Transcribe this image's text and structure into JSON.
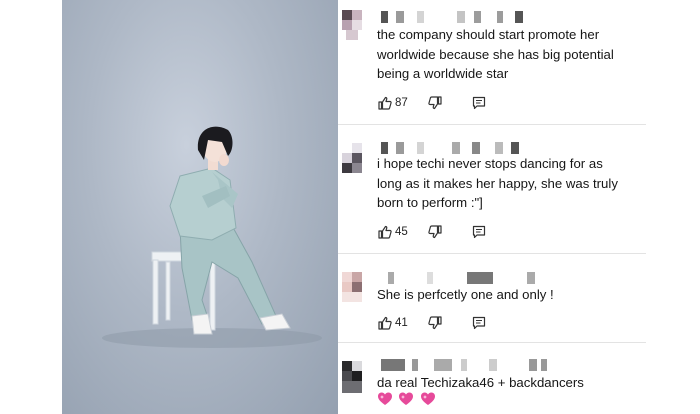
{
  "photo": {
    "icon": "seated-person-photo"
  },
  "comments": [
    {
      "text": "the company should start promote her\nworldwide because she has big potential\nbeing a worldwide star",
      "likes": "87"
    },
    {
      "text": "i hope techi never stops dancing for as\nlong as it makes her happy, she was truly\nborn to perform :\"]",
      "likes": "45"
    },
    {
      "text": "She is perfcetly one and only !",
      "likes": "41"
    },
    {
      "text": "da real Techizaka46 + backdancers",
      "emoji": "💖💖💖"
    }
  ],
  "icons": {
    "like": "thumbs-up-icon",
    "dislike": "thumbs-down-icon",
    "reply": "reply-icon",
    "more": "more-vert-icon"
  },
  "colors": {
    "emoji_heart": "#e64a9a",
    "text": "#161616"
  }
}
